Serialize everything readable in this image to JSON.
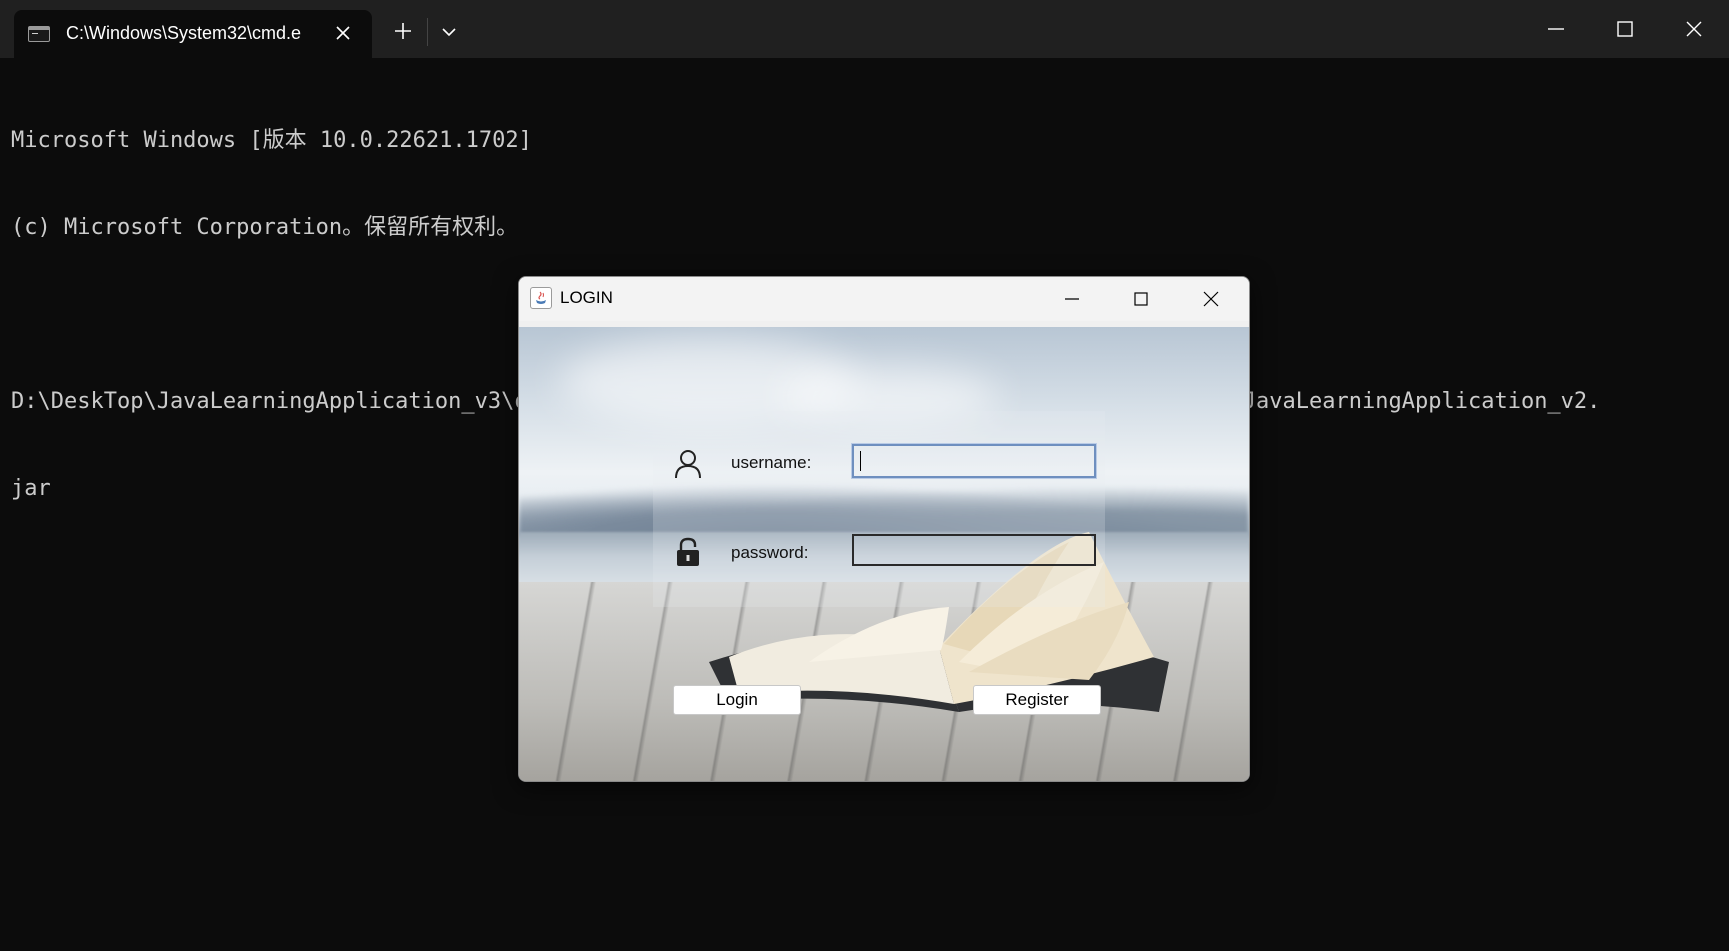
{
  "terminal": {
    "tab_title": "C:\\Windows\\System32\\cmd.e",
    "tab_icon": "cmd-icon",
    "console_lines": [
      "Microsoft Windows [版本 10.0.22621.1702]",
      "(c) Microsoft Corporation。保留所有权利。",
      "",
      "D:\\DeskTop\\JavaLearningApplication_v3\\out\\artifacts\\JavaLearningApplication_v2_jar>java -jar JavaLearningApplication_v2.",
      "jar"
    ],
    "colors": {
      "background": "#0c0c0c",
      "tabbar": "#202020",
      "text": "#cccccc"
    }
  },
  "login_dialog": {
    "title": "LOGIN",
    "username_label": "username:",
    "password_label": "password:",
    "username_value": "",
    "password_value": "",
    "login_button": "Login",
    "register_button": "Register",
    "icons": {
      "title": "java-icon",
      "user": "user-icon",
      "lock": "lock-icon"
    },
    "colors": {
      "input_focus_border": "#6e8fbf"
    }
  }
}
